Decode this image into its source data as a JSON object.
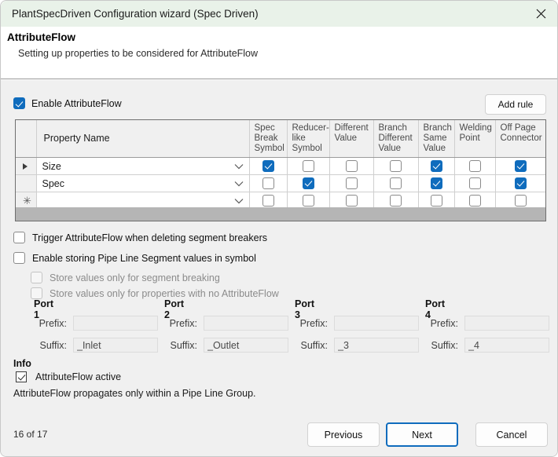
{
  "window": {
    "title": "PlantSpecDriven Configuration wizard (Spec Driven)",
    "close_icon": "close-icon",
    "titlebar_color": "#e9f2e9"
  },
  "header": {
    "title": "AttributeFlow",
    "subtitle": "Setting up properties to be considered for AttributeFlow"
  },
  "toolbar": {
    "enable_label": "Enable AttributeFlow",
    "enable_checked": true,
    "add_rule_label": "Add rule"
  },
  "grid": {
    "columns": [
      {
        "label": "",
        "key": "rowhdr"
      },
      {
        "label": "Property Name",
        "key": "property_name"
      },
      {
        "label": "Spec Break Symbol",
        "key": "spec_break_symbol"
      },
      {
        "label": "Reducer-like Symbol",
        "key": "reducer_like_symbol"
      },
      {
        "label": "Different Value",
        "key": "different_value"
      },
      {
        "label": "Branch Different Value",
        "key": "branch_different_value"
      },
      {
        "label": "Branch Same Value",
        "key": "branch_same_value"
      },
      {
        "label": "Welding Point",
        "key": "welding_point"
      },
      {
        "label": "Off Page Connector",
        "key": "off_page_connector"
      }
    ],
    "rows": [
      {
        "indicator": "current",
        "property_name": "Size",
        "checks": [
          true,
          false,
          false,
          false,
          true,
          false,
          true
        ]
      },
      {
        "indicator": "",
        "property_name": "Spec",
        "checks": [
          false,
          true,
          false,
          false,
          true,
          false,
          true
        ]
      },
      {
        "indicator": "new",
        "property_name": "",
        "checks": [
          false,
          false,
          false,
          false,
          false,
          false,
          false
        ]
      }
    ]
  },
  "options": [
    {
      "label": "Trigger AttributeFlow when deleting segment breakers",
      "checked": false,
      "disabled": false
    },
    {
      "label": "Enable storing Pipe Line Segment values in symbol",
      "checked": false,
      "disabled": false
    },
    {
      "label": "Store values only for segment breaking",
      "checked": false,
      "disabled": true
    },
    {
      "label": "Store values only for properties with no AttributeFlow",
      "checked": false,
      "disabled": true
    }
  ],
  "ports": [
    {
      "title": "Port 1",
      "prefix": "",
      "suffix": "_Inlet",
      "prefix_label": "Prefix:",
      "suffix_label": "Suffix:"
    },
    {
      "title": "Port 2",
      "prefix": "",
      "suffix": "_Outlet",
      "prefix_label": "Prefix:",
      "suffix_label": "Suffix:"
    },
    {
      "title": "Port 3",
      "prefix": "",
      "suffix": "_3",
      "prefix_label": "Prefix:",
      "suffix_label": "Suffix:"
    },
    {
      "title": "Port 4",
      "prefix": "",
      "suffix": "_4",
      "prefix_label": "Prefix:",
      "suffix_label": "Suffix:"
    }
  ],
  "info": {
    "title": "Info",
    "active_label": "AttributeFlow active",
    "active_checked": true,
    "note": "AttributeFlow propagates only within a Pipe Line Group."
  },
  "footer": {
    "page_indicator": "16 of 17",
    "previous_label": "Previous",
    "next_label": "Next",
    "cancel_label": "Cancel"
  },
  "colors": {
    "accent": "#0f6cbd",
    "titlebar": "#e9f2e9",
    "body": "#f0f0f0"
  }
}
